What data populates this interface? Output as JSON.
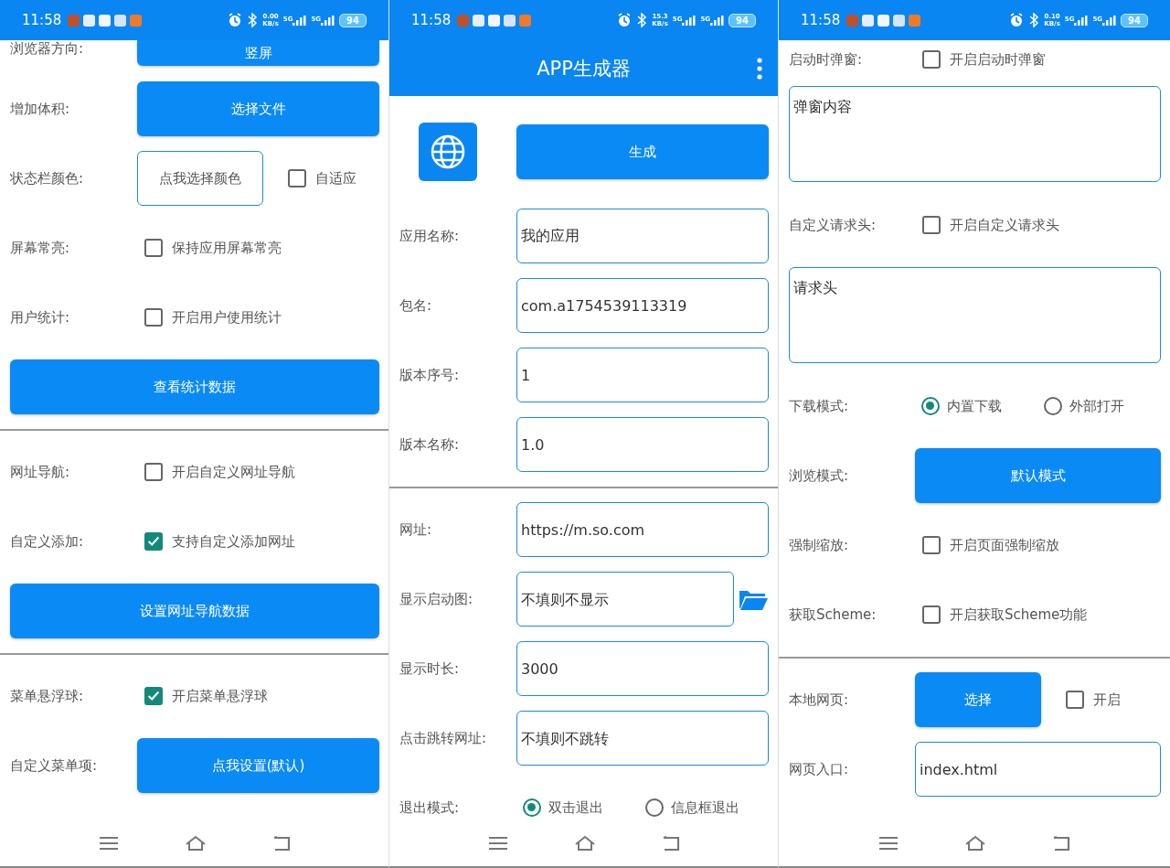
{
  "panels": [
    {
      "status_bar": {
        "time": "11:58",
        "speed": "0.00",
        "speed_unit": "KB/s",
        "network_1": "5G",
        "network_2": "5G",
        "battery": "94"
      },
      "rows": [
        {
          "kind": "row",
          "label": "浏览器方向:",
          "controls": [
            {
              "kind": "button",
              "text": "竖屏"
            }
          ]
        },
        {
          "kind": "row",
          "label": "增加体积:",
          "controls": [
            {
              "kind": "button",
              "text": "选择文件"
            }
          ]
        },
        {
          "kind": "row",
          "label": "状态栏颜色:",
          "controls": [
            {
              "kind": "outline_button",
              "text": "点我选择颜色"
            },
            {
              "kind": "checkbox",
              "text": "自适应",
              "checked": false
            }
          ]
        },
        {
          "kind": "row",
          "label": "屏幕常亮:",
          "controls": [
            {
              "kind": "checkbox",
              "text": "保持应用屏幕常亮",
              "checked": false
            }
          ]
        },
        {
          "kind": "row",
          "label": "用户统计:",
          "controls": [
            {
              "kind": "checkbox",
              "text": "开启用户使用统计",
              "checked": false
            }
          ]
        },
        {
          "kind": "wide_button",
          "label": "查看统计数据"
        },
        {
          "kind": "divider"
        },
        {
          "kind": "row",
          "label": "网址导航:",
          "controls": [
            {
              "kind": "checkbox",
              "text": "开启自定义网址导航",
              "checked": false
            }
          ]
        },
        {
          "kind": "row",
          "label": "自定义添加:",
          "controls": [
            {
              "kind": "checkbox",
              "text": "支持自定义添加网址",
              "checked": true
            }
          ]
        },
        {
          "kind": "wide_button",
          "label": "设置网址导航数据"
        },
        {
          "kind": "divider"
        },
        {
          "kind": "row",
          "label": "菜单悬浮球:",
          "controls": [
            {
              "kind": "checkbox",
              "text": "开启菜单悬浮球",
              "checked": true
            }
          ]
        },
        {
          "kind": "row",
          "label": "自定义菜单项:",
          "controls": [
            {
              "kind": "button",
              "text": "点我设置(默认)"
            }
          ]
        }
      ]
    },
    {
      "status_bar": {
        "time": "11:58",
        "speed": "15.3",
        "speed_unit": "KB/s",
        "network_1": "5G",
        "network_2": "5G",
        "battery": "94"
      },
      "app_bar": {
        "title": "APP生成器"
      },
      "rows": [
        {
          "kind": "header",
          "label": "生成"
        },
        {
          "kind": "row",
          "label": "应用名称:",
          "controls": [
            {
              "kind": "field",
              "value": "我的应用"
            }
          ]
        },
        {
          "kind": "row",
          "label": "包名:",
          "controls": [
            {
              "kind": "field",
              "value": "com.a1754539113319"
            }
          ]
        },
        {
          "kind": "row",
          "label": "版本序号:",
          "controls": [
            {
              "kind": "field",
              "value": "1"
            }
          ]
        },
        {
          "kind": "row",
          "label": "版本名称:",
          "controls": [
            {
              "kind": "field",
              "value": "1.0"
            }
          ]
        },
        {
          "kind": "divider"
        },
        {
          "kind": "row",
          "label": "网址:",
          "controls": [
            {
              "kind": "field",
              "value": "https://m.so.com"
            }
          ]
        },
        {
          "kind": "row",
          "label": "显示启动图:",
          "controls": [
            {
              "kind": "field",
              "placeholder": "不填则不显示"
            },
            {
              "kind": "folder"
            }
          ]
        },
        {
          "kind": "row",
          "label": "显示时长:",
          "controls": [
            {
              "kind": "field",
              "value": "3000"
            }
          ]
        },
        {
          "kind": "row",
          "label": "点击跳转网址:",
          "controls": [
            {
              "kind": "field",
              "placeholder": "不填则不跳转"
            }
          ]
        },
        {
          "kind": "row",
          "label": "退出模式:",
          "controls": [
            {
              "kind": "radio",
              "text": "双击退出",
              "selected": true
            },
            {
              "kind": "radio",
              "text": "信息框退出",
              "selected": false
            }
          ]
        }
      ]
    },
    {
      "status_bar": {
        "time": "11:58",
        "speed": "0.10",
        "speed_unit": "KB/s",
        "network_1": "5G",
        "network_2": "5G",
        "battery": "94"
      },
      "rows": [
        {
          "kind": "row",
          "label": "启动时弹窗:",
          "controls": [
            {
              "kind": "checkbox",
              "text": "开启启动时弹窗",
              "checked": false
            }
          ]
        },
        {
          "kind": "textarea",
          "placeholder": "弹窗内容"
        },
        {
          "kind": "row",
          "label": "自定义请求头:",
          "controls": [
            {
              "kind": "checkbox",
              "text": "开启自定义请求头",
              "checked": false
            }
          ]
        },
        {
          "kind": "textarea",
          "placeholder": "请求头"
        },
        {
          "kind": "row",
          "label": "下载模式:",
          "controls": [
            {
              "kind": "radio",
              "text": "内置下载",
              "selected": true
            },
            {
              "kind": "radio",
              "text": "外部打开",
              "selected": false
            }
          ]
        },
        {
          "kind": "row",
          "label": "浏览模式:",
          "controls": [
            {
              "kind": "button",
              "text": "默认模式"
            }
          ]
        },
        {
          "kind": "row",
          "label": "强制缩放:",
          "controls": [
            {
              "kind": "checkbox",
              "text": "开启页面强制缩放",
              "checked": false
            }
          ]
        },
        {
          "kind": "row",
          "label": "获取Scheme:",
          "controls": [
            {
              "kind": "checkbox",
              "text": "开启获取Scheme功能",
              "checked": false
            }
          ]
        },
        {
          "kind": "divider"
        },
        {
          "kind": "row",
          "label": "本地网页:",
          "controls": [
            {
              "kind": "button",
              "text": "选择"
            },
            {
              "kind": "checkbox",
              "text": "开启",
              "checked": false
            }
          ]
        },
        {
          "kind": "row",
          "label": "网页入口:",
          "controls": [
            {
              "kind": "field",
              "value": "index.html"
            }
          ]
        }
      ]
    }
  ]
}
